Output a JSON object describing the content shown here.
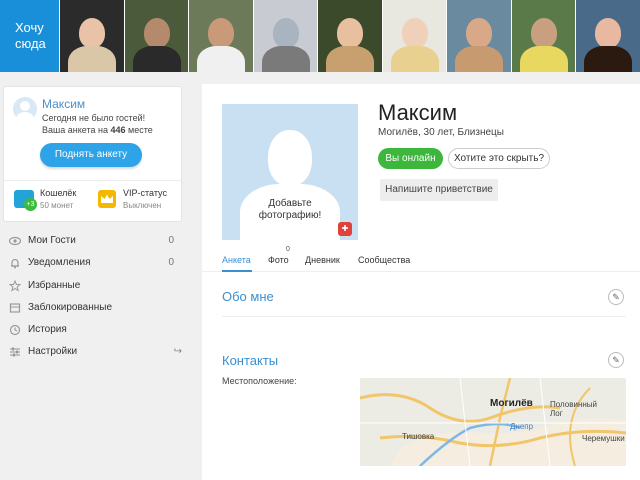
{
  "top_strip": {
    "want_here_label": "Хочу сюда",
    "photos": [
      {
        "hair": "#d9c7a8",
        "skin": "#e8c3a8",
        "bg": "#2b2b2b"
      },
      {
        "hair": "#2a2a2a",
        "skin": "#b58a6c",
        "bg": "#4a5a3a"
      },
      {
        "hair": "#1a1a1a",
        "skin": "#c89a7a",
        "bg": "#6c7a5a"
      },
      {
        "hair": "#7a7a7a",
        "skin": "#a8b4c0",
        "bg": "#c8ccd2"
      },
      {
        "hair": "#c8a070",
        "skin": "#e8c0a0",
        "bg": "#3a4a2a"
      },
      {
        "hair": "#e8d090",
        "skin": "#f0d0b8",
        "bg": "#e8e8e0"
      },
      {
        "hair": "#c89a70",
        "skin": "#d8a888",
        "bg": "#6a8aa0"
      },
      {
        "hair": "#e8d860",
        "skin": "#c8a080",
        "bg": "#5a7a4a"
      },
      {
        "hair": "#2a1a10",
        "skin": "#e8b8a0",
        "bg": "#4a6a8a"
      }
    ]
  },
  "sidebar": {
    "user_card": {
      "name": "Максим",
      "no_guests": "Сегодня не было гостей!",
      "rank_prefix": "Ваша анкета на",
      "rank_value": "446",
      "rank_suffix": "месте",
      "raise_button": "Поднять анкету",
      "wallet_title": "Кошелёк",
      "wallet_sub": "50 монет",
      "wallet_badge": "+3",
      "vip_title": "VIP-статус",
      "vip_sub": "Выключен"
    },
    "menu": [
      {
        "label": "Мои Гости",
        "count": "0"
      },
      {
        "label": "Уведомления",
        "count": "0"
      },
      {
        "label": "Избранные",
        "count": ""
      },
      {
        "label": "Заблокированные",
        "count": ""
      },
      {
        "label": "История",
        "count": ""
      },
      {
        "label": "Настройки",
        "count": ""
      }
    ]
  },
  "profile": {
    "photo_placeholder_line1": "Добавьте",
    "photo_placeholder_line2": "фотографию!",
    "name": "Максим",
    "info": "Могилёв, 30 лет, Близнецы",
    "online_button": "Вы онлайн",
    "hide_button": "Хотите это скрыть?",
    "greeting_button": "Напишите приветствие"
  },
  "tabs": [
    {
      "label": "Анкета",
      "active": true
    },
    {
      "label": "Фото",
      "active": false
    },
    {
      "label": "Дневник",
      "active": false
    },
    {
      "label": "Сообщества",
      "active": false
    }
  ],
  "photo_count": "0",
  "sections": {
    "about_title": "Обо мне",
    "contacts_title": "Контакты",
    "location_label": "Местоположение:"
  },
  "map": {
    "city": "Могилёв",
    "labels": [
      "Половинный Лог",
      "Тишовка",
      "Черемушки",
      "Днепр"
    ]
  },
  "colors": {
    "accent": "#3a8fd0",
    "online": "#3cb73c",
    "raise": "#2ea3e8",
    "want_tile": "#1a8fd9"
  }
}
